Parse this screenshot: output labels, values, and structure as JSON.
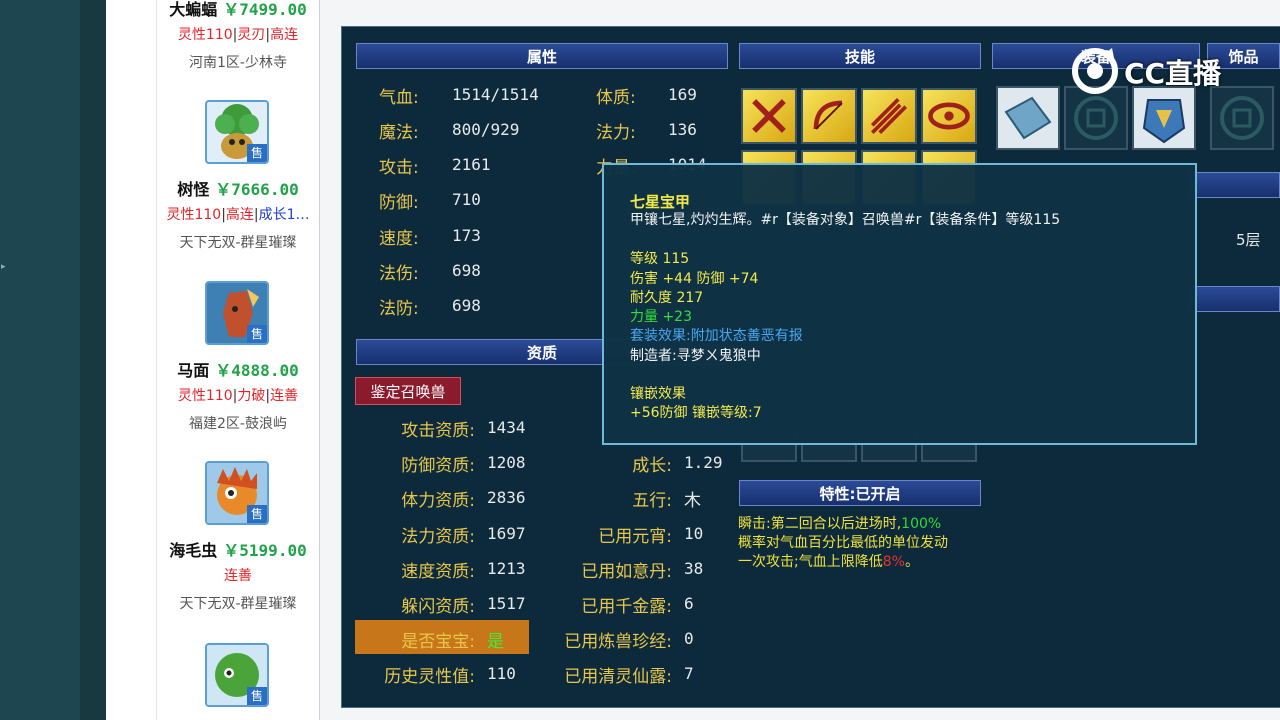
{
  "listings": [
    {
      "name": "大蝙蝠",
      "price": "￥7499.00",
      "tags": [
        {
          "text": "灵性110",
          "color": "red"
        },
        {
          "text": "灵刃",
          "color": "red"
        },
        {
          "text": "高连",
          "color": "red"
        }
      ],
      "server": "河南1区-少林寺"
    },
    {
      "name": "树怪",
      "price": "￥7666.00",
      "tags": [
        {
          "text": "灵性110",
          "color": "red"
        },
        {
          "text": "高连",
          "color": "red"
        },
        {
          "text": "成长1…",
          "color": "blue"
        }
      ],
      "server": "天下无双-群星璀璨",
      "sell_tag": "售"
    },
    {
      "name": "马面",
      "price": "￥4888.00",
      "tags": [
        {
          "text": "灵性110",
          "color": "red"
        },
        {
          "text": "力破",
          "color": "red"
        },
        {
          "text": "连善",
          "color": "red"
        }
      ],
      "server": "福建2区-鼓浪屿",
      "sell_tag": "售"
    },
    {
      "name": "海毛虫",
      "price": "￥5199.00",
      "tags": [
        {
          "text": "连善",
          "color": "red"
        }
      ],
      "server": "天下无双-群星璀璨",
      "sell_tag": "售"
    },
    {
      "sell_tag": "售"
    }
  ],
  "sections": {
    "attributes": "属性",
    "skills": "技能",
    "equipment": "装备",
    "accessory": "饰品",
    "aptitude": "资质",
    "trait": "特性:已开启"
  },
  "attributes": [
    {
      "label": "气血:",
      "value": "1514/1514"
    },
    {
      "label": "魔法:",
      "value": "800/929"
    },
    {
      "label": "攻击:",
      "value": "2161"
    },
    {
      "label": "防御:",
      "value": "710"
    },
    {
      "label": "速度:",
      "value": "173"
    },
    {
      "label": "法伤:",
      "value": "698"
    },
    {
      "label": "法防:",
      "value": "698"
    }
  ],
  "attributes_right": [
    {
      "label": "体质:",
      "value": "169"
    },
    {
      "label": "法力:",
      "value": "136"
    },
    {
      "label": "力量:",
      "value": "1014"
    }
  ],
  "identify_button": "鉴定召唤兽",
  "aptitudes_left": [
    {
      "label": "攻击资质:",
      "value": "1434"
    },
    {
      "label": "防御资质:",
      "value": "1208"
    },
    {
      "label": "体力资质:",
      "value": "2836"
    },
    {
      "label": "法力资质:",
      "value": "1697"
    },
    {
      "label": "速度资质:",
      "value": "1213"
    },
    {
      "label": "躲闪资质:",
      "value": "1517"
    },
    {
      "label": "是否宝宝:",
      "value": "是"
    },
    {
      "label": "历史灵性值:",
      "value": "110"
    }
  ],
  "aptitudes_right": [
    {
      "label": "成长:",
      "value": "1.29"
    },
    {
      "label": "五行:",
      "value": "木"
    },
    {
      "label": "已用元宵:",
      "value": "10"
    },
    {
      "label": "已用如意丹:",
      "value": "38"
    },
    {
      "label": "已用千金露:",
      "value": "6"
    },
    {
      "label": "已用炼兽珍经:",
      "value": "0"
    },
    {
      "label": "已用清灵仙露:",
      "value": "7"
    }
  ],
  "layer_text": "5层",
  "trait_desc": {
    "line1": "瞬击:第二回合以后进场时,",
    "pct": "100%",
    "line2": "概率对气血百分比最低的单位发动",
    "line3": "一次攻击;气血上限降低",
    "pct2": "8%",
    "end": "。"
  },
  "tooltip": {
    "title": "七星宝甲",
    "desc": "甲镶七星,灼灼生辉。#r【装备对象】召唤兽#r【装备条件】等级115",
    "level": "等级 115",
    "stats": "伤害 +44 防御 +74",
    "durability": "耐久度 217",
    "strength": "力量 +23",
    "set_effect": "套装效果:附加状态善恶有报",
    "maker": "制造者:寻梦ㄨ鬼狼中",
    "inlay_title": "镶嵌效果",
    "inlay": "+56防御 镶嵌等级:7"
  },
  "watermark": "CC直播",
  "colors": {
    "accent_gold": "#e8c64a",
    "price_green": "#22a34a",
    "tag_red": "#e0262a",
    "tag_blue": "#1d3fd0"
  }
}
